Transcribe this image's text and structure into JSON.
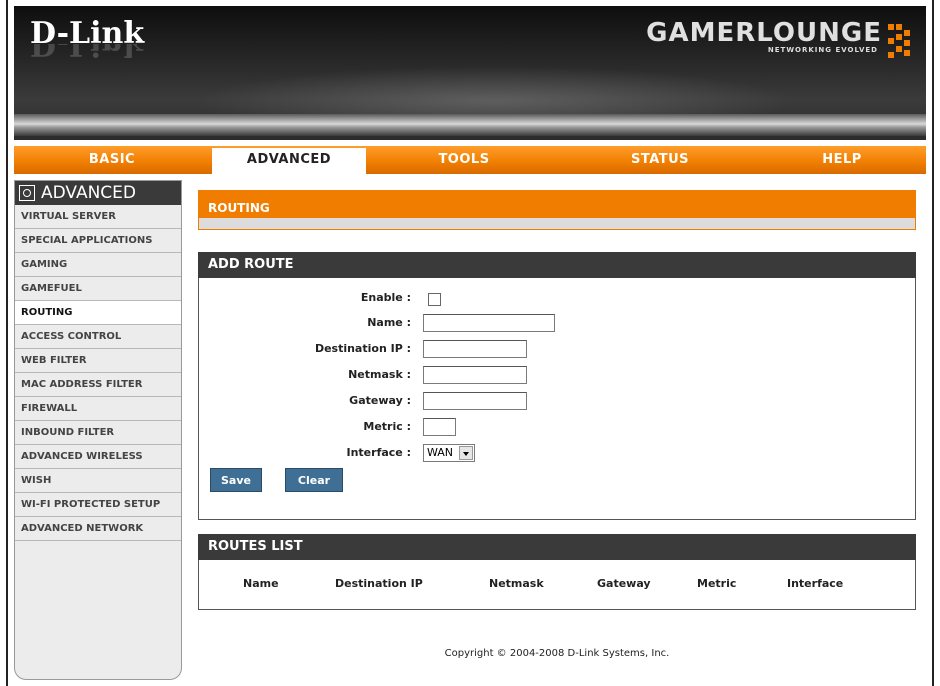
{
  "header": {
    "brand": "D-Link",
    "product": "GAMERLOUNGE",
    "tagline": "NETWORKING EVOLVED"
  },
  "nav": {
    "tabs": [
      "BASIC",
      "ADVANCED",
      "TOOLS",
      "STATUS",
      "HELP"
    ],
    "active": "ADVANCED"
  },
  "sidebar": {
    "title": "ADVANCED",
    "items": [
      "VIRTUAL SERVER",
      "SPECIAL APPLICATIONS",
      "GAMING",
      "GAMEFUEL",
      "ROUTING",
      "ACCESS CONTROL",
      "WEB FILTER",
      "MAC ADDRESS FILTER",
      "FIREWALL",
      "INBOUND FILTER",
      "ADVANCED WIRELESS",
      "WISH",
      "WI-FI PROTECTED SETUP",
      "ADVANCED NETWORK"
    ],
    "active": "ROUTING"
  },
  "routing": {
    "title": "ROUTING"
  },
  "add_route": {
    "title": "ADD ROUTE",
    "enable_label": "Enable :",
    "enable_checked": false,
    "name_label": "Name :",
    "name_value": "",
    "dest_label": "Destination IP :",
    "dest_value": "",
    "netmask_label": "Netmask :",
    "netmask_value": "",
    "gateway_label": "Gateway :",
    "gateway_value": "",
    "metric_label": "Metric :",
    "metric_value": "",
    "interface_label": "Interface :",
    "interface_value": "WAN",
    "save_label": "Save",
    "clear_label": "Clear"
  },
  "routes_list": {
    "title": "ROUTES LIST",
    "columns": [
      "Name",
      "Destination IP",
      "Netmask",
      "Gateway",
      "Metric",
      "Interface"
    ]
  },
  "footer": {
    "copyright": "Copyright © 2004-2008 D-Link Systems, Inc."
  },
  "colors": {
    "accent": "#f07d00",
    "button": "#3f6f94",
    "dark": "#3a3a3a"
  }
}
